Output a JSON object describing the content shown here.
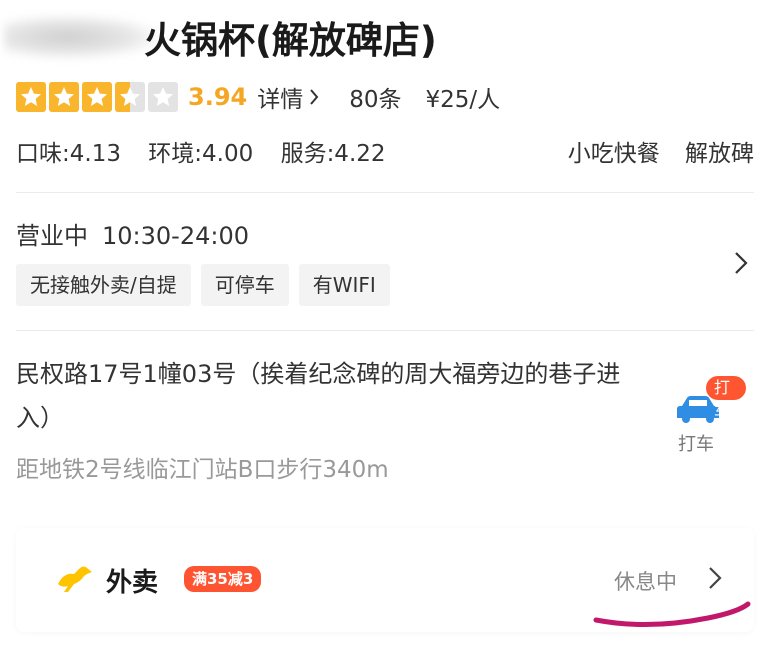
{
  "shop": {
    "title": "火锅杯(解放碑店)",
    "rating": {
      "stars": 3.5,
      "score": "3.94",
      "details_label": "详情"
    },
    "review_count": "80条",
    "price_per_person": "¥25/人",
    "scores": {
      "taste": "口味:4.13",
      "environment": "环境:4.00",
      "service": "服务:4.22"
    },
    "category": "小吃快餐",
    "area": "解放碑"
  },
  "hours": {
    "status": "营业中",
    "time": "10:30-24:00"
  },
  "tags": [
    "无接触外卖/自提",
    "可停车",
    "有WIFI"
  ],
  "address": {
    "text": "民权路17号1幢03号（挨着纪念碑的周大福旁边的巷子进入）",
    "distance": "距地铁2号线临江门站B口步行340m"
  },
  "taxi": {
    "badge": "打车",
    "label": "打车",
    "icon": "taxi-car-icon",
    "color": "#2f8de4"
  },
  "delivery": {
    "label": "外卖",
    "promo": "满35减3",
    "status": "休息中",
    "icon": "kangaroo-icon",
    "color": "#ffc300"
  },
  "colors": {
    "star": "#f9b52c",
    "score": "#f5a623",
    "promo": "#ff5431",
    "annotation": "#c2186b"
  }
}
